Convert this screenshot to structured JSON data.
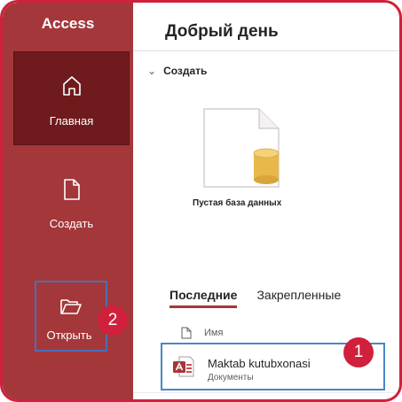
{
  "app": {
    "name": "Access",
    "accent_color": "#a4373a",
    "highlight_color": "#d0203b"
  },
  "sidebar": {
    "items": [
      {
        "label": "Главная",
        "icon": "home-icon",
        "selected": true
      },
      {
        "label": "Создать",
        "icon": "new-file-icon",
        "selected": false
      },
      {
        "label": "Открыть",
        "icon": "folder-open-icon",
        "selected": false
      }
    ]
  },
  "main": {
    "greeting": "Добрый день",
    "create_section": {
      "title": "Создать",
      "templates": [
        {
          "label": "Пустая база данных",
          "icon": "blank-database-icon"
        }
      ]
    },
    "tabs": [
      {
        "label": "Последние",
        "active": true
      },
      {
        "label": "Закрепленные",
        "active": false
      }
    ],
    "list": {
      "name_header": "Имя",
      "files": [
        {
          "name": "Maktab kutubxonasi",
          "location": "Документы",
          "icon": "access-file-icon"
        }
      ]
    }
  },
  "callouts": {
    "open_badge": "2",
    "file_badge": "1"
  }
}
